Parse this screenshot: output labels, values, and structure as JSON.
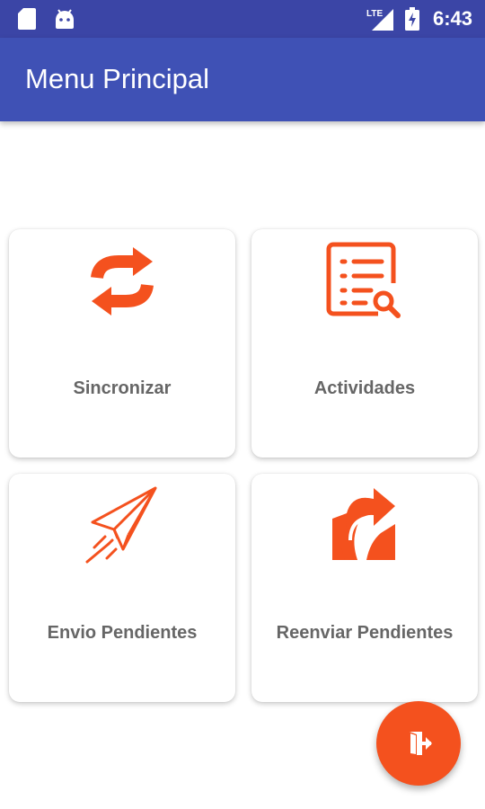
{
  "status_bar": {
    "network": "LTE",
    "time": "6:43",
    "icons": [
      "sd-card-icon",
      "android-icon",
      "lte-signal-icon",
      "battery-charging-icon"
    ]
  },
  "app_bar": {
    "title": "Menu Principal"
  },
  "menu": {
    "items": [
      {
        "label": "Sincronizar",
        "icon": "sync-icon"
      },
      {
        "label": "Actividades",
        "icon": "activity-list-search-icon"
      },
      {
        "label": "Envio Pendientes",
        "icon": "paper-plane-icon"
      },
      {
        "label": "Reenviar Pendientes",
        "icon": "resend-arrow-icon"
      }
    ]
  },
  "fab": {
    "icon": "logout-door-icon"
  },
  "colors": {
    "status_bar": "#3b45a6",
    "app_bar": "#3f51b5",
    "accent": "#f4511e",
    "label_text": "#666666"
  }
}
